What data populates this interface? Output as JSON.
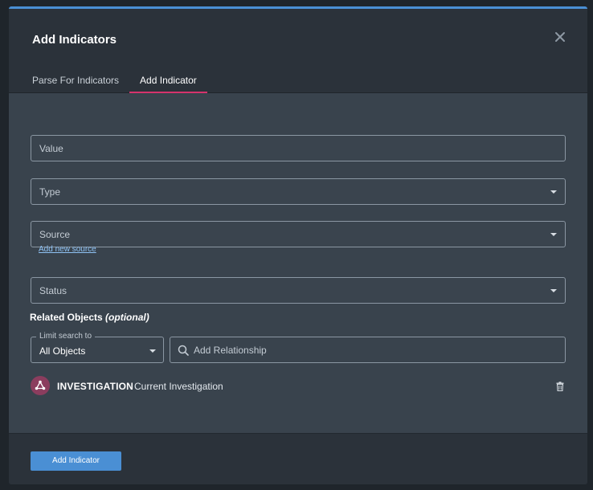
{
  "modal": {
    "title": "Add Indicators",
    "tabs": [
      {
        "label": "Parse For Indicators",
        "active": false
      },
      {
        "label": "Add Indicator",
        "active": true
      }
    ]
  },
  "form": {
    "value_label": "Value",
    "type_label": "Type",
    "source_label": "Source",
    "add_source_link": "Add new source",
    "status_label": "Status"
  },
  "related": {
    "title": "Related Objects",
    "title_suffix": "(optional)",
    "limit_legend": "Limit search to",
    "limit_value": "All Objects",
    "search_placeholder": "Add Relationship",
    "items": [
      {
        "type": "INVESTIGATION",
        "name": "Current Investigation",
        "icon": "investigation-icon"
      }
    ]
  },
  "footer": {
    "primary_label": "Add Indicator"
  },
  "colors": {
    "accent": "#4a8fd4",
    "tab_underline": "#d6336c",
    "investigation_badge": "#8b3d5e"
  }
}
